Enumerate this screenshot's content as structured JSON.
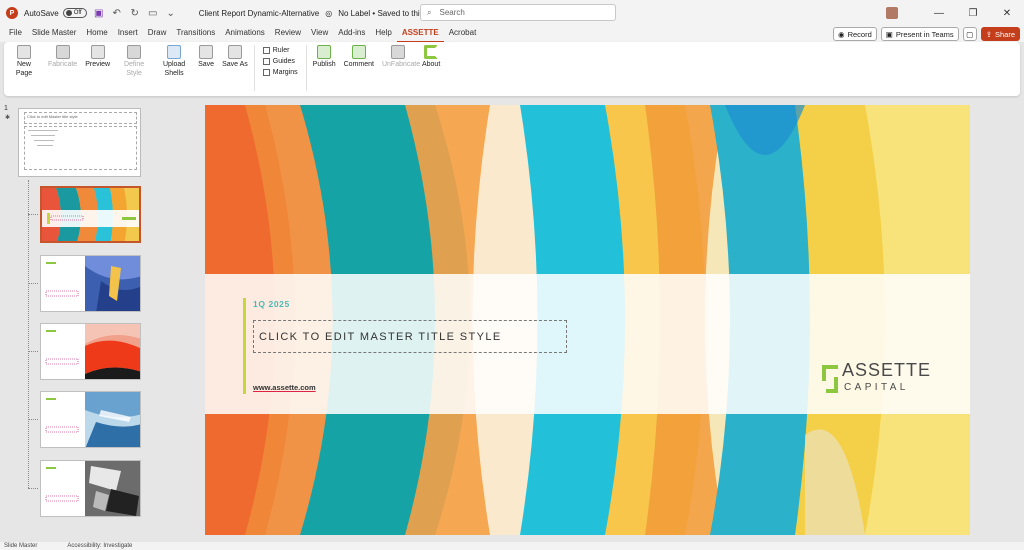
{
  "titlebar": {
    "autosave_label": "AutoSave",
    "autosave_state": "Off",
    "doc_title": "Client Report Dynamic-Alternative",
    "label_status": "No Label • Saved to this PC",
    "search_placeholder": "Search"
  },
  "menu": {
    "tabs": [
      "File",
      "Slide Master",
      "Home",
      "Insert",
      "Draw",
      "Transitions",
      "Animations",
      "Review",
      "View",
      "Add-ins",
      "Help",
      "ASSETTE",
      "Acrobat"
    ],
    "active_tab": "ASSETTE",
    "record_label": "Record",
    "present_label": "Present in Teams",
    "share_label": "Share"
  },
  "ribbon": {
    "buttons": [
      {
        "label": "New Page",
        "disabled": false,
        "icon": "new-page-icon"
      },
      {
        "label": "Fabricate",
        "disabled": true,
        "icon": "fabricate-icon"
      },
      {
        "label": "Preview",
        "disabled": false,
        "icon": "preview-icon"
      },
      {
        "label": "Define Style",
        "disabled": true,
        "icon": "define-style-icon"
      },
      {
        "label": "Upload Shells",
        "disabled": false,
        "icon": "upload-icon"
      },
      {
        "label": "Save",
        "disabled": false,
        "icon": "save-icon"
      },
      {
        "label": "Save As",
        "disabled": false,
        "icon": "save-as-icon"
      }
    ],
    "checkboxes": [
      "Ruler",
      "Guides",
      "Margins"
    ],
    "buttons2": [
      {
        "label": "Publish",
        "disabled": false,
        "icon": "publish-icon"
      },
      {
        "label": "Comment",
        "disabled": false,
        "icon": "comment-icon"
      },
      {
        "label": "UnFabricate",
        "disabled": true,
        "icon": "unfabricate-icon"
      },
      {
        "label": "About",
        "disabled": false,
        "icon": "assette-logo-icon"
      }
    ]
  },
  "thumbnails": {
    "master_number": "1",
    "master_title": "Click to edit Master title style"
  },
  "slide": {
    "quarter": "1Q 2025",
    "title_placeholder": "CLICK TO EDIT MASTER TITLE STYLE",
    "url": "www.assette.com",
    "brand_name": "ASSETTE",
    "brand_sub": "CAPITAL"
  },
  "status": {
    "view": "Slide Master",
    "accessibility": "Accessibility: Investigate"
  },
  "colors": {
    "accent": "#c43e1c",
    "brand_green": "#8dc63f",
    "teal": "#4bb9b6"
  }
}
